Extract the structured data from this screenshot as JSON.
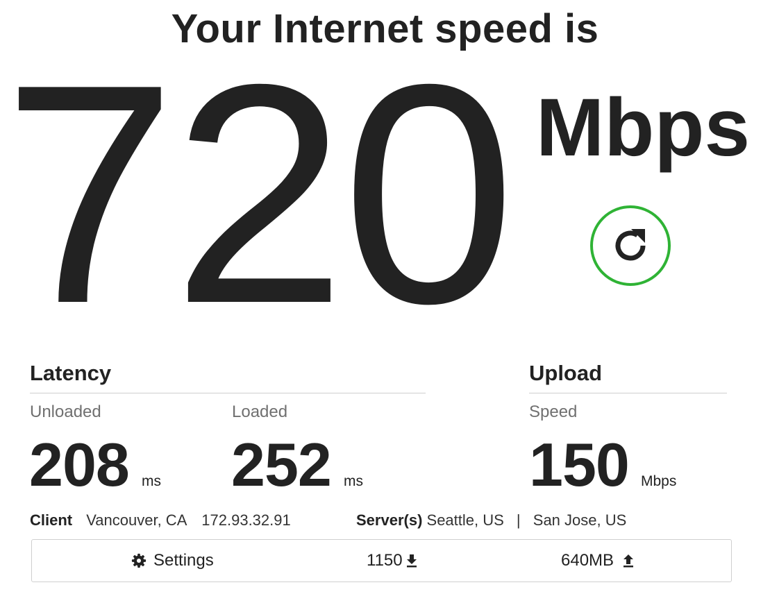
{
  "header": {
    "title": "Your Internet speed is"
  },
  "speed": {
    "value": "720",
    "units": "Mbps"
  },
  "refresh": {
    "icon": "refresh-icon",
    "accent_color": "#2fb335"
  },
  "latency": {
    "title": "Latency",
    "unloaded": {
      "label": "Unloaded",
      "value": "208",
      "unit": "ms"
    },
    "loaded": {
      "label": "Loaded",
      "value": "252",
      "unit": "ms"
    }
  },
  "upload": {
    "title": "Upload",
    "speed": {
      "label": "Speed",
      "value": "150",
      "unit": "Mbps"
    }
  },
  "client": {
    "label": "Client",
    "location": "Vancouver, CA",
    "ip": "172.93.32.91"
  },
  "servers": {
    "label": "Server(s)",
    "primary": "Seattle, US",
    "separator": "|",
    "secondary": "San Jose, US"
  },
  "footer": {
    "settings_label": "Settings",
    "settings_icon": "gear-icon",
    "download_amount": "1150",
    "download_icon": "download-arrow-icon",
    "upload_amount": "640MB",
    "upload_icon": "upload-arrow-icon"
  }
}
